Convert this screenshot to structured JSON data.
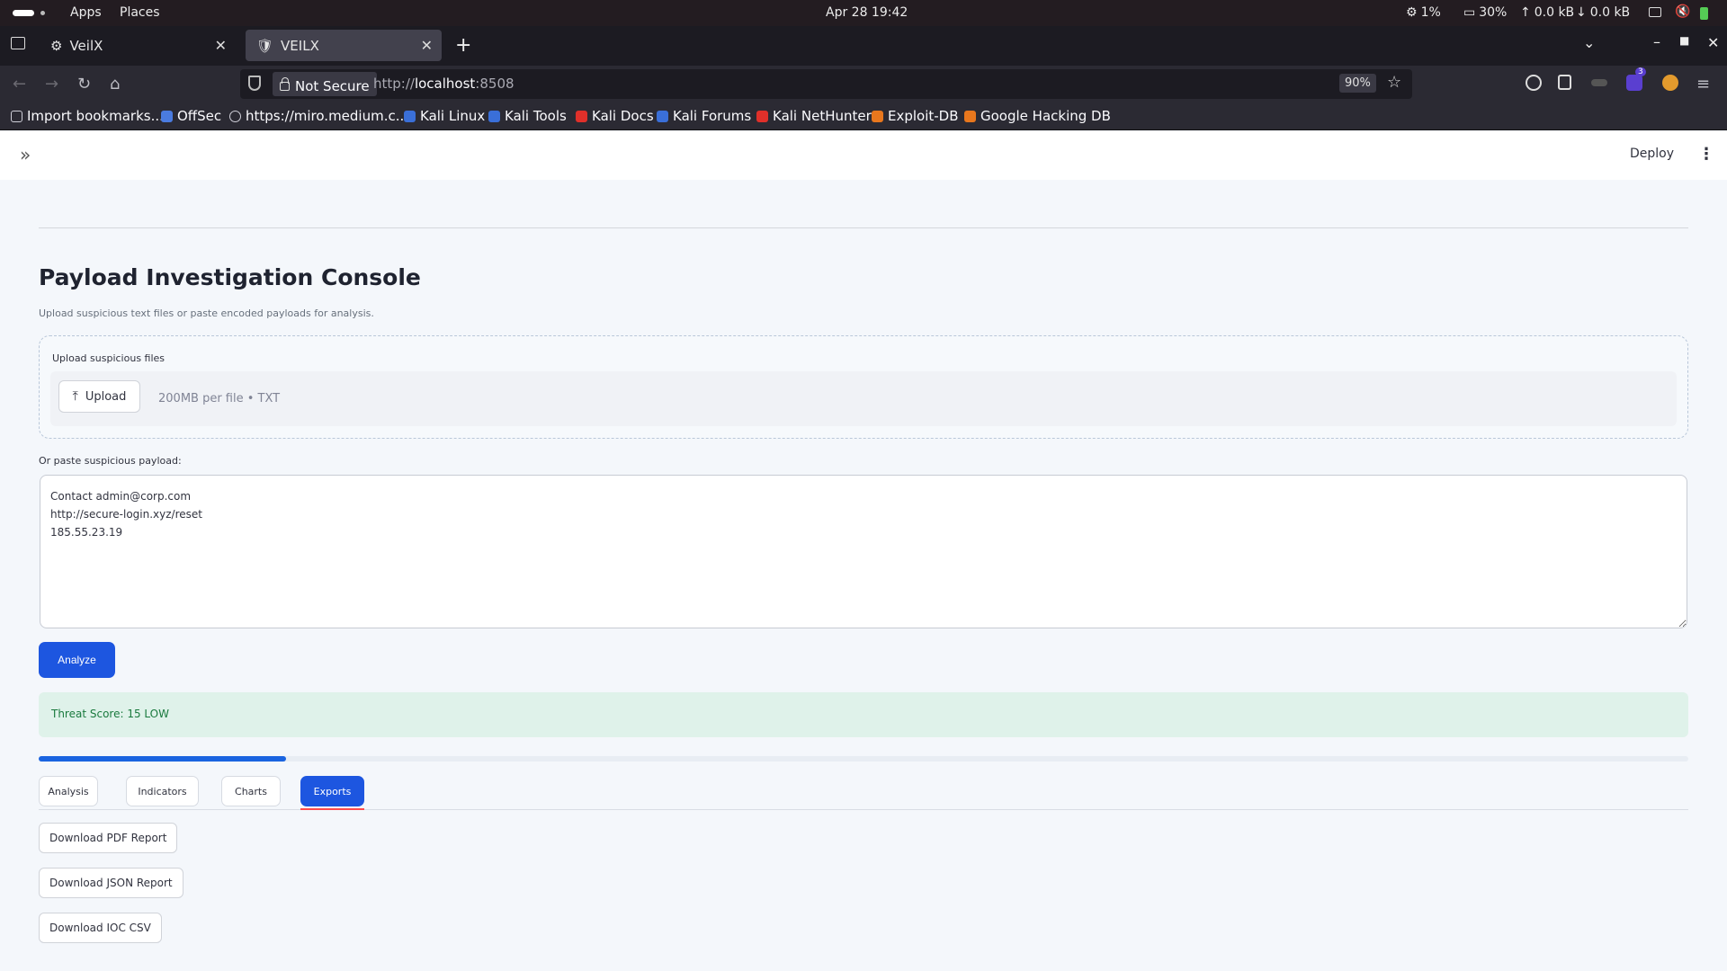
{
  "system_bar": {
    "apps": "Apps",
    "places": "Places",
    "clock": "Apr 28  19:42",
    "cpu": "1%",
    "memory": "30%",
    "net_up": "0.0 kB",
    "net_down": "0.0 kB"
  },
  "browser": {
    "tabs": [
      {
        "title": "VeilX",
        "active": false
      },
      {
        "title": "VEILX",
        "active": true
      }
    ],
    "security_label": "Not Secure",
    "url_prefix": "http://",
    "url_host": "localhost",
    "url_port": ":8508",
    "zoom": "90%",
    "extension_badge": "3",
    "bookmarks": [
      {
        "label": "Import bookmarks...",
        "color": "#cfcfd8"
      },
      {
        "label": "OffSec",
        "color": "#4a7be0"
      },
      {
        "label": "https://miro.medium.c...",
        "color": "#cfcfd8"
      },
      {
        "label": "Kali Linux",
        "color": "#3a6fd8"
      },
      {
        "label": "Kali Tools",
        "color": "#3a6fd8"
      },
      {
        "label": "Kali Docs",
        "color": "#e0302a"
      },
      {
        "label": "Kali Forums",
        "color": "#3a6fd8"
      },
      {
        "label": "Kali NetHunter",
        "color": "#e0302a"
      },
      {
        "label": "Exploit-DB",
        "color": "#e8771d"
      },
      {
        "label": "Google Hacking DB",
        "color": "#e8771d"
      }
    ]
  },
  "app_header": {
    "deploy_label": "Deploy"
  },
  "page": {
    "title": "Payload Investigation Console",
    "subtitle": "Upload suspicious text files or paste encoded payloads for analysis.",
    "upload": {
      "label": "Upload suspicious files",
      "button": "Upload",
      "hint": "200MB per file • TXT"
    },
    "paste": {
      "label": "Or paste suspicious payload:",
      "value": "Contact admin@corp.com\nhttp://secure-login.xyz/reset\n185.55.23.19"
    },
    "analyze_label": "Analyze",
    "result": {
      "text": "Threat Score: 15 LOW",
      "score": 15
    },
    "progress_fraction": 0.15,
    "tabs": [
      "Analysis",
      "Indicators",
      "Charts",
      "Exports"
    ],
    "active_tab": "Exports",
    "downloads": [
      "Download PDF Report",
      "Download JSON Report",
      "Download IOC CSV"
    ]
  },
  "colors": {
    "accent": "#1d56e0",
    "success_bg": "#dff2ea",
    "success_text": "#1a7a3e",
    "tab_indicator": "#ff4b4b"
  }
}
